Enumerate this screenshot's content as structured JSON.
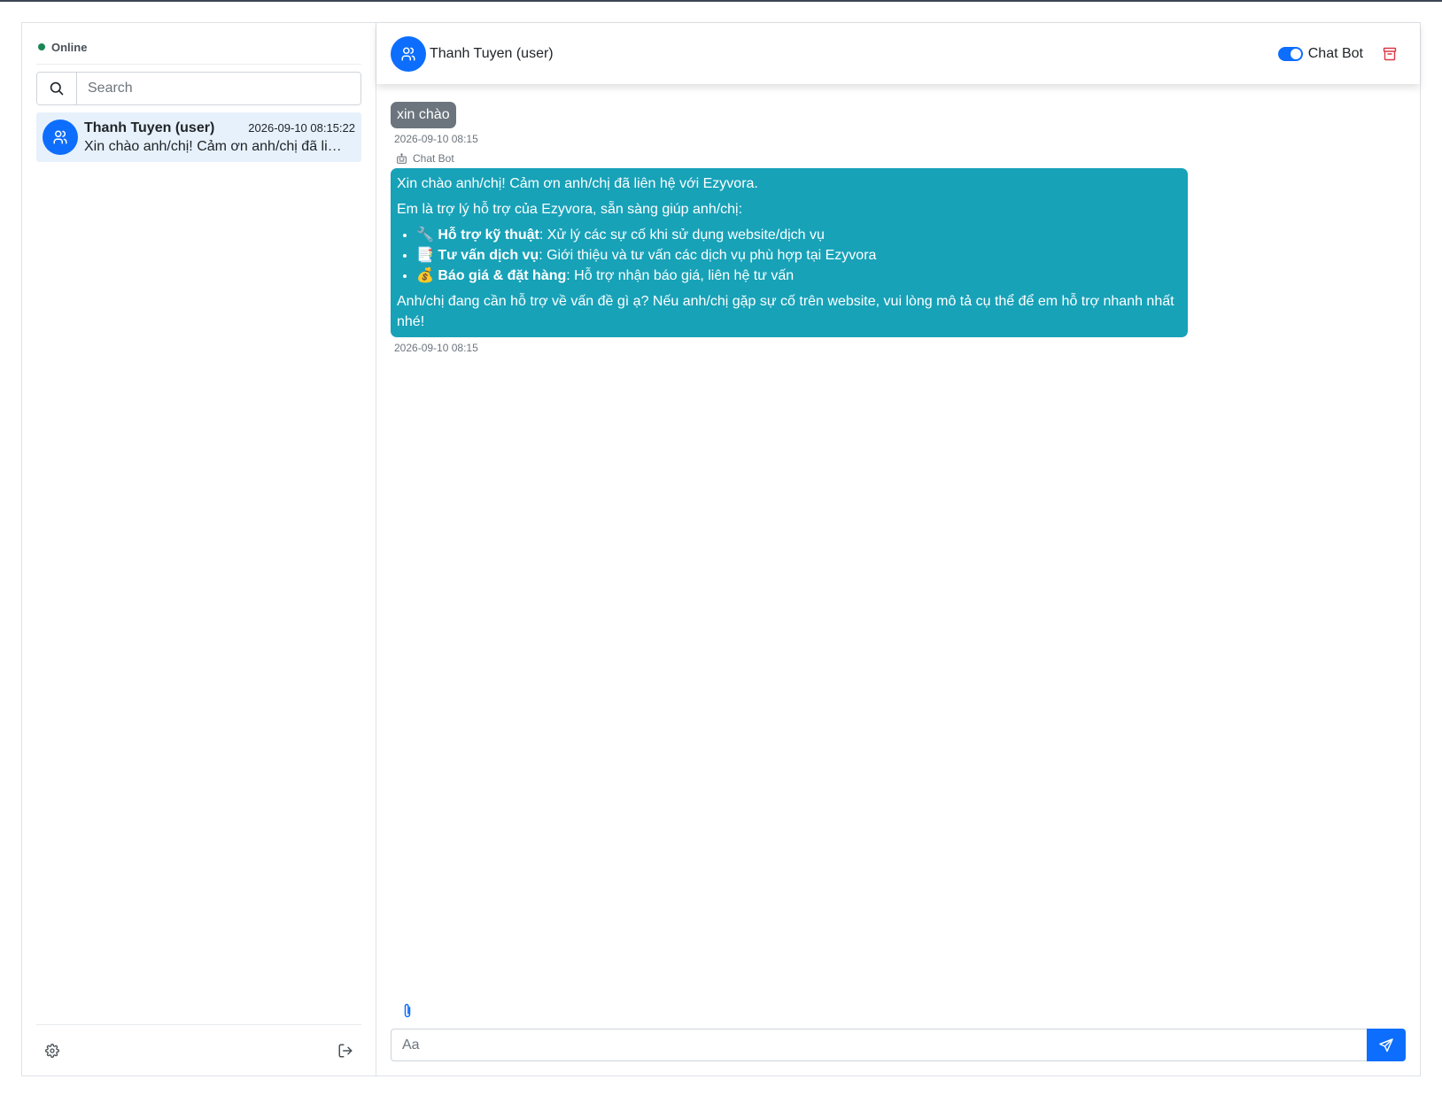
{
  "sidebar": {
    "status": "Online",
    "search_placeholder": "Search",
    "conversations": [
      {
        "name": "Thanh Tuyen (user)",
        "time": "2026-09-10 08:15:22",
        "preview": "Xin chào anh/chị! Cảm ơn anh/chị đã liên hệ với Ezyvora."
      }
    ]
  },
  "chat": {
    "header_name": "Thanh Tuyen (user)",
    "chatbot_toggle_label": "Chat Bot",
    "chatbot_enabled": true,
    "messages": {
      "user_text": "xin chào",
      "user_time": "2026-09-10 08:15",
      "bot_sender": "Chat Bot",
      "bot_line1": "Xin chào anh/chị! Cảm ơn anh/chị đã liên hệ với Ezyvora.",
      "bot_line2": "Em là trợ lý hỗ trợ của Ezyvora, sẵn sàng giúp anh/chị:",
      "bot_items": [
        {
          "emoji": "🔧",
          "title": "Hỗ trợ kỹ thuật",
          "text": ": Xử lý các sự cố khi sử dụng website/dịch vụ"
        },
        {
          "emoji": "📑",
          "title": "Tư vấn dịch vụ",
          "text": ": Giới thiệu và tư vấn các dịch vụ phù hợp tại Ezyvora"
        },
        {
          "emoji": "💰",
          "title": "Báo giá & đặt hàng",
          "text": ": Hỗ trợ nhận báo giá, liên hệ tư vấn"
        }
      ],
      "bot_line3": "Anh/chị đang cần hỗ trợ về vấn đề gì ạ? Nếu anh/chị gặp sự cố trên website, vui lòng mô tả cụ thể để em hỗ trợ nhanh nhất nhé!",
      "bot_time": "2026-09-10 08:15"
    },
    "input_placeholder": "Aa"
  },
  "colors": {
    "primary": "#0d6efd",
    "bot_bubble": "#17a2b8",
    "user_bubble": "#6c757d",
    "online": "#198754",
    "danger": "#dc3545"
  }
}
